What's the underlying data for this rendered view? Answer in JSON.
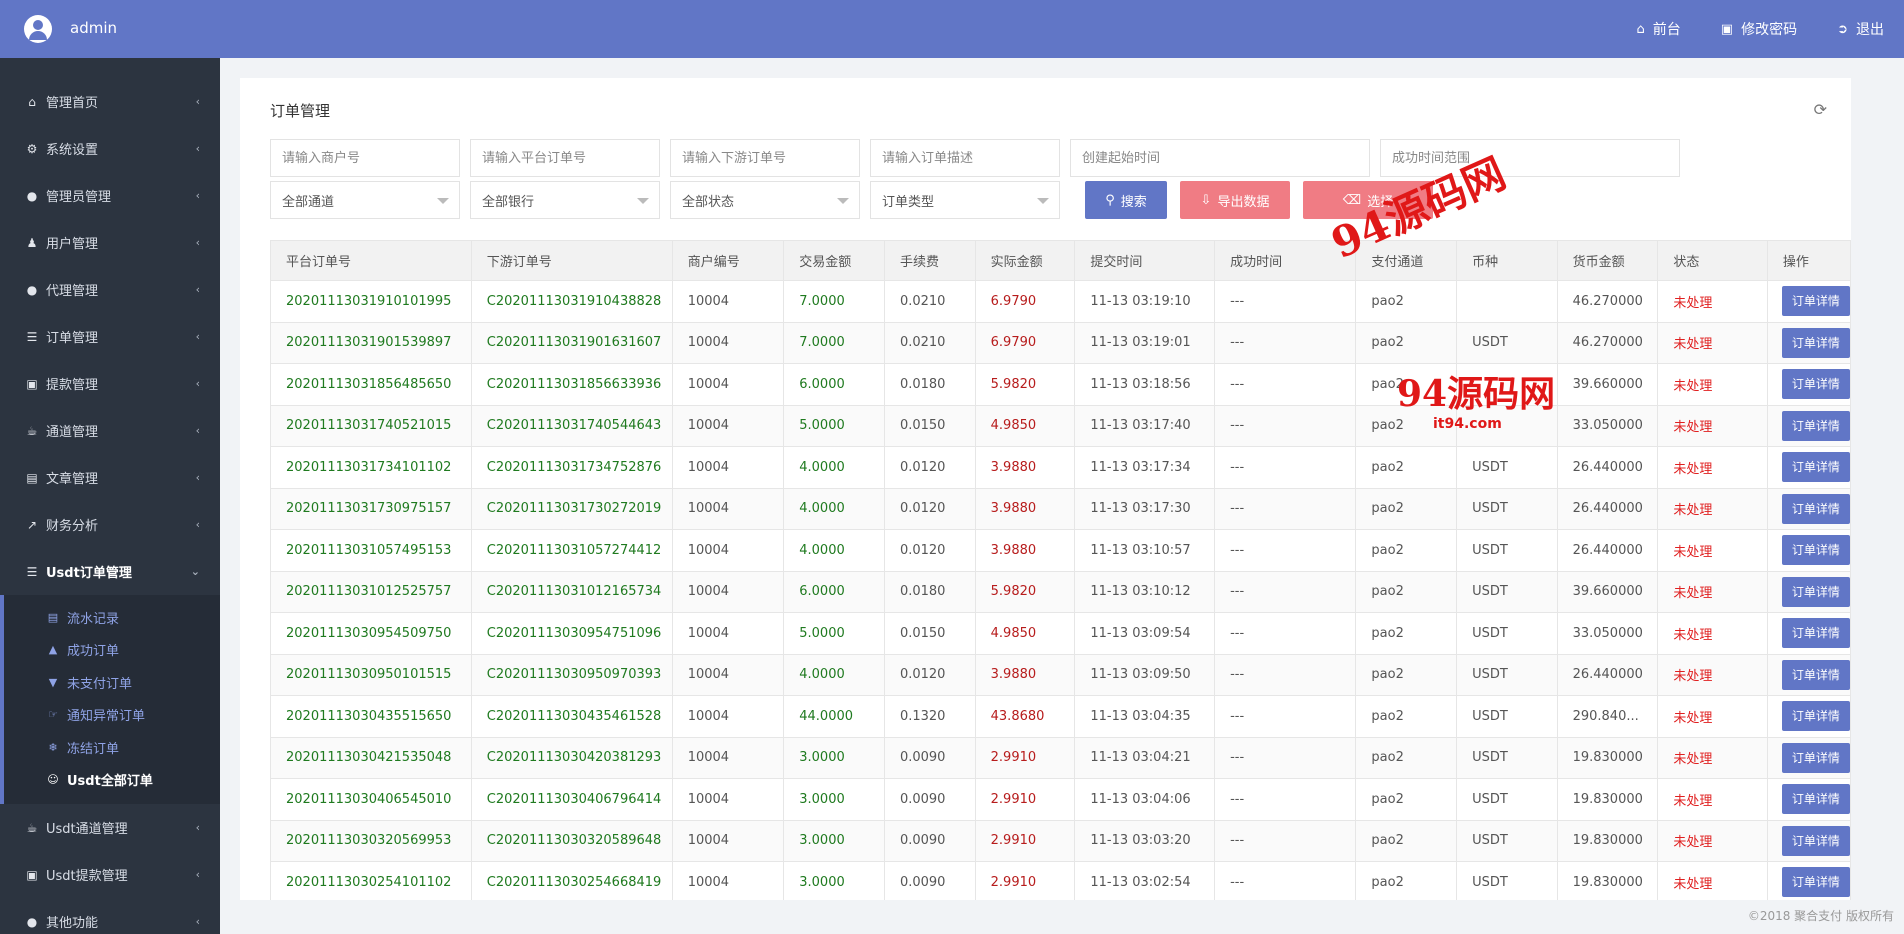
{
  "topbar": {
    "username": "admin",
    "links": [
      {
        "icon": "home-icon",
        "label": "前台"
      },
      {
        "icon": "lock-icon",
        "label": "修改密码"
      },
      {
        "icon": "sign-out-icon",
        "label": "退出"
      }
    ]
  },
  "sidebar": {
    "items": [
      {
        "icon": "home-icon",
        "label": "管理首页"
      },
      {
        "icon": "gears-icon",
        "label": "系统设置"
      },
      {
        "icon": "user-circle-icon",
        "label": "管理员管理"
      },
      {
        "icon": "users-icon",
        "label": "用户管理"
      },
      {
        "icon": "user-circle-icon",
        "label": "代理管理"
      },
      {
        "icon": "list-icon",
        "label": "订单管理"
      },
      {
        "icon": "lock-icon",
        "label": "提款管理"
      },
      {
        "icon": "bank-icon",
        "label": "通道管理"
      },
      {
        "icon": "book-icon",
        "label": "文章管理"
      },
      {
        "icon": "chart-icon",
        "label": "财务分析"
      },
      {
        "icon": "list-icon",
        "label": "Usdt订单管理"
      }
    ],
    "submenu": [
      {
        "icon": "list-alt-icon",
        "label": "流水记录"
      },
      {
        "icon": "thumbs-up-icon",
        "label": "成功订单"
      },
      {
        "icon": "thumbs-down-icon",
        "label": "未支付订单"
      },
      {
        "icon": "hand-pointer-icon",
        "label": "通知异常订单"
      },
      {
        "icon": "snowflake-icon",
        "label": "冻结订单"
      },
      {
        "icon": "smile-icon",
        "label": "Usdt全部订单"
      }
    ],
    "items_after": [
      {
        "icon": "bank-icon",
        "label": "Usdt通道管理"
      },
      {
        "icon": "lock-icon",
        "label": "Usdt提款管理"
      },
      {
        "icon": "user-circle-icon",
        "label": "其他功能"
      }
    ]
  },
  "panel": {
    "title": "订单管理",
    "filters": {
      "merchant_placeholder": "请输入商户号",
      "platform_order_placeholder": "请输入平台订单号",
      "downstream_order_placeholder": "请输入下游订单号",
      "order_desc_placeholder": "请输入订单描述",
      "create_start_placeholder": "创建起始时间",
      "success_time_placeholder": "成功时间范围",
      "channel_select": "全部通道",
      "bank_select": "全部银行",
      "status_select": "全部状态",
      "type_select": "订单类型"
    },
    "buttons": {
      "search": "搜索",
      "export": "导出数据",
      "batch": "选择"
    }
  },
  "table": {
    "headers": [
      "平台订单号",
      "下游订单号",
      "商户编号",
      "交易金额",
      "手续费",
      "实际金额",
      "提交时间",
      "成功时间",
      "支付通道",
      "币种",
      "货币金额",
      "状态",
      "操作"
    ],
    "detail_label": "订单详情",
    "rows": [
      [
        "20201113031910101995",
        "C20201113031910438828",
        "10004",
        "7.0000",
        "0.0210",
        "6.9790",
        "11-13 03:19:10",
        "---",
        "pao2",
        "",
        "46.270000",
        "未处理"
      ],
      [
        "20201113031901539897",
        "C20201113031901631607",
        "10004",
        "7.0000",
        "0.0210",
        "6.9790",
        "11-13 03:19:01",
        "---",
        "pao2",
        "USDT",
        "46.270000",
        "未处理"
      ],
      [
        "20201113031856485650",
        "C20201113031856633936",
        "10004",
        "6.0000",
        "0.0180",
        "5.9820",
        "11-13 03:18:56",
        "---",
        "pao2",
        "",
        "39.660000",
        "未处理"
      ],
      [
        "20201113031740521015",
        "C20201113031740544643",
        "10004",
        "5.0000",
        "0.0150",
        "4.9850",
        "11-13 03:17:40",
        "---",
        "pao2",
        "",
        "33.050000",
        "未处理"
      ],
      [
        "20201113031734101102",
        "C20201113031734752876",
        "10004",
        "4.0000",
        "0.0120",
        "3.9880",
        "11-13 03:17:34",
        "---",
        "pao2",
        "USDT",
        "26.440000",
        "未处理"
      ],
      [
        "20201113031730975157",
        "C20201113031730272019",
        "10004",
        "4.0000",
        "0.0120",
        "3.9880",
        "11-13 03:17:30",
        "---",
        "pao2",
        "USDT",
        "26.440000",
        "未处理"
      ],
      [
        "20201113031057495153",
        "C20201113031057274412",
        "10004",
        "4.0000",
        "0.0120",
        "3.9880",
        "11-13 03:10:57",
        "---",
        "pao2",
        "USDT",
        "26.440000",
        "未处理"
      ],
      [
        "20201113031012525757",
        "C20201113031012165734",
        "10004",
        "6.0000",
        "0.0180",
        "5.9820",
        "11-13 03:10:12",
        "---",
        "pao2",
        "USDT",
        "39.660000",
        "未处理"
      ],
      [
        "20201113030954509750",
        "C20201113030954751096",
        "10004",
        "5.0000",
        "0.0150",
        "4.9850",
        "11-13 03:09:54",
        "---",
        "pao2",
        "USDT",
        "33.050000",
        "未处理"
      ],
      [
        "20201113030950101515",
        "C20201113030950970393",
        "10004",
        "4.0000",
        "0.0120",
        "3.9880",
        "11-13 03:09:50",
        "---",
        "pao2",
        "USDT",
        "26.440000",
        "未处理"
      ],
      [
        "20201113030435515650",
        "C20201113030435461528",
        "10004",
        "44.0000",
        "0.1320",
        "43.8680",
        "11-13 03:04:35",
        "---",
        "pao2",
        "USDT",
        "290.840...",
        "未处理"
      ],
      [
        "20201113030421535048",
        "C20201113030420381293",
        "10004",
        "3.0000",
        "0.0090",
        "2.9910",
        "11-13 03:04:21",
        "---",
        "pao2",
        "USDT",
        "19.830000",
        "未处理"
      ],
      [
        "20201113030406545010",
        "C20201113030406796414",
        "10004",
        "3.0000",
        "0.0090",
        "2.9910",
        "11-13 03:04:06",
        "---",
        "pao2",
        "USDT",
        "19.830000",
        "未处理"
      ],
      [
        "20201113030320569953",
        "C20201113030320589648",
        "10004",
        "3.0000",
        "0.0090",
        "2.9910",
        "11-13 03:03:20",
        "---",
        "pao2",
        "USDT",
        "19.830000",
        "未处理"
      ],
      [
        "20201113030254101102",
        "C20201113030254668419",
        "10004",
        "3.0000",
        "0.0090",
        "2.9910",
        "11-13 03:02:54",
        "---",
        "pao2",
        "USDT",
        "19.830000",
        "未处理"
      ]
    ]
  },
  "footer": "©2018 聚合支付 版权所有",
  "watermark": {
    "line1": "94源码网",
    "line2": "94源码网",
    "line3": "it94.com"
  },
  "colors": {
    "accent": "#6176c6",
    "sidebar": "#2c3440",
    "danger_button": "#f07c84",
    "status": "#e02020"
  }
}
